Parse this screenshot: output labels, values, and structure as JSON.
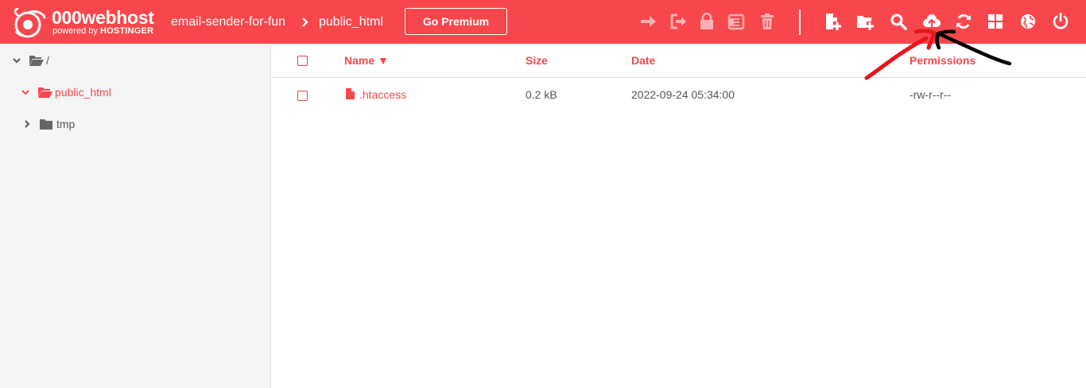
{
  "header": {
    "brand_name": "000webhost",
    "brand_sub_prefix": "powered by ",
    "brand_sub_strong": "HOSTINGER",
    "breadcrumb": [
      "email-sender-for-fun",
      "public_html"
    ],
    "premium_label": "Go Premium",
    "toolbar_icons": [
      "move-icon",
      "rename-icon",
      "lock-icon",
      "archive-icon",
      "delete-icon",
      "new-file-icon",
      "new-folder-icon",
      "search-icon",
      "upload-icon",
      "refresh-icon",
      "grid-view-icon",
      "globe-icon",
      "power-icon"
    ]
  },
  "sidebar": {
    "items": [
      {
        "label": "/",
        "state": "expanded"
      },
      {
        "label": "public_html",
        "state": "expanded-active"
      },
      {
        "label": "tmp",
        "state": "collapsed"
      }
    ]
  },
  "table": {
    "columns": {
      "name": "Name ▼",
      "size": "Size",
      "date": "Date",
      "permissions": "Permissions"
    },
    "rows": [
      {
        "name": ".htaccess",
        "size": "0.2 kB",
        "date": "2022-09-24 05:34:00",
        "permissions": "-rw-r--r--"
      }
    ]
  },
  "colors": {
    "brand": "#f8474c",
    "toolbar_disabled": "#fbb0b2",
    "annotation_red": "#e8141c",
    "annotation_black": "#000000"
  }
}
